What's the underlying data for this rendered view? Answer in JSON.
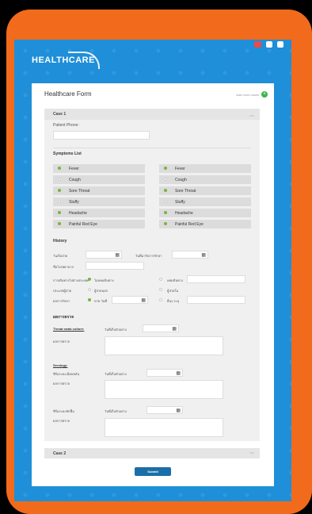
{
  "header": {
    "brand": "HEALTHCARE"
  },
  "form": {
    "title": "Healthcare Form",
    "add_case_label": "Add more cases",
    "submit_label": "Submit"
  },
  "case1": {
    "title": "Case 1",
    "patient_phone_label": "Patient Phone:",
    "symptoms_title": "Symptoms List",
    "symptoms_left": [
      {
        "label": "Fever",
        "checked": true
      },
      {
        "label": "Cough",
        "checked": false
      },
      {
        "label": "Sore Throat",
        "checked": true
      },
      {
        "label": "Stuffy",
        "checked": false
      },
      {
        "label": "Headache",
        "checked": true
      },
      {
        "label": "Painful Red Eye",
        "checked": true
      }
    ],
    "symptoms_right": [
      {
        "label": "Fever",
        "checked": true
      },
      {
        "label": "Cough",
        "checked": false
      },
      {
        "label": "Sore Throat",
        "checked": true
      },
      {
        "label": "Stuffy",
        "checked": false
      },
      {
        "label": "Headache",
        "checked": true
      },
      {
        "label": "Painful Red Eye",
        "checked": true
      }
    ],
    "history_title": "History",
    "history": {
      "date_label": "วันเริ่มป่วย",
      "visit_date_label": "วันที่มารับการรักษา",
      "hospital_label": "ชื่อโรงพยาบาล",
      "travel_label": "การเดินทางไปต่างประเทศ",
      "travel_opt1": "ไม่เคยเดินทาง",
      "travel_opt2": "เคยเดินทาง",
      "patient_type_label": "ประเภทผู้ป่วย",
      "patient_opt1": "ผู้ป่วยนอก",
      "patient_opt2": "ผู้ป่วยใน",
      "result_label": "ผลการรักษา",
      "result_opt1": "หาย วันที่",
      "result_opt2": "อื่นๆ ระบุ"
    },
    "lab_title": "ผลการตรวจ",
    "lab": {
      "throat_label": "Throat swab culture:",
      "throat_date": "วันที่เก็บตัวอย่าง",
      "result_label": "ผลการตรวจ",
      "serology_label": "Serology:",
      "acute_label": "ซีรั่มระยะเฉียบพลัน",
      "acute_date": "วันที่เก็บตัวอย่าง",
      "acute_result": "ผลการตรวจ",
      "conv_label": "ซีรั่มระยะพักฟื้น",
      "conv_date": "วันที่เก็บตัวอย่าง",
      "conv_result": "ผลการตรวจ"
    }
  },
  "case2": {
    "title": "Case 2"
  },
  "colors": {
    "accent": "#1e8fd8",
    "frame": "#f26a1b",
    "check": "#7bb33d",
    "submit": "#1b6ea8"
  }
}
